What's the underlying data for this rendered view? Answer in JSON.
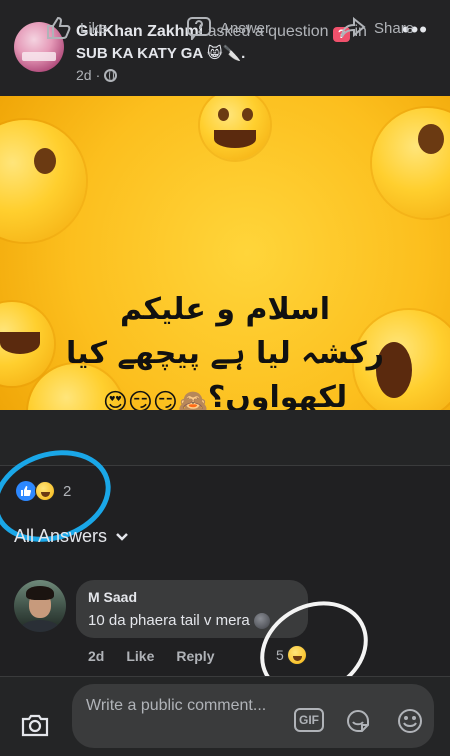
{
  "post": {
    "author": "GulKhan Zakhmi",
    "action_text": "asked a question",
    "in_text": "in",
    "group_name": "SUB KA KATY GA",
    "group_suffix": "😸🔪.",
    "time": "2d",
    "privacy_icon": "globe-icon",
    "more_icon": "more-options-icon"
  },
  "image_text": {
    "line1": "اسلام و علیکم",
    "line2": "رکشہ لیا ہے پیچھے کیا",
    "line3": "لکھواوں؟",
    "line3_emojis": "🙈😏😏😍"
  },
  "actions": {
    "like": "Like",
    "answer": "Answer",
    "share": "Share"
  },
  "reactions": {
    "types": [
      "like-reaction-icon",
      "haha-reaction-icon"
    ],
    "count": "2"
  },
  "answers_filter": {
    "label": "All Answers"
  },
  "comment": {
    "author": "M Saad",
    "text": "10 da phaera tail v mera",
    "time": "2d",
    "like_label": "Like",
    "reply_label": "Reply",
    "reaction_count": "5"
  },
  "composer": {
    "placeholder": "Write a public comment...",
    "gif_label": "GIF"
  },
  "colors": {
    "background": "#202022",
    "card": "#242526",
    "bubble": "#3a3b3c",
    "text": "#e4e6eb",
    "muted": "#b0b3b8",
    "question_badge": "#f0516c",
    "like_blue": "#2d88ff",
    "annotation_blue": "#1aa7e8",
    "annotation_white": "#f4f4f4"
  }
}
